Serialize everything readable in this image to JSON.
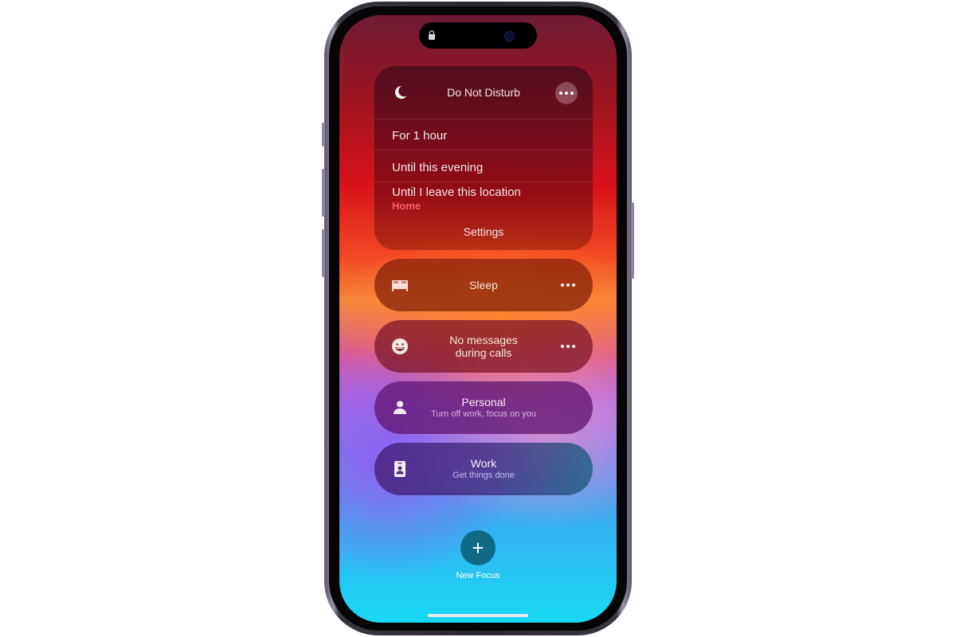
{
  "device": {
    "model": "iPhone",
    "status_icon": "lock-icon"
  },
  "dnd": {
    "title": "Do Not Disturb",
    "icon": "moon-icon",
    "more_icon": "ellipsis-icon",
    "options": [
      {
        "label": "For 1 hour"
      },
      {
        "label": "Until this evening"
      },
      {
        "label": "Until I leave this location",
        "sublabel": "Home"
      }
    ],
    "settings_label": "Settings",
    "accent_color": "#ff5b6e"
  },
  "focus_modes": [
    {
      "name": "Sleep",
      "subtitle": "",
      "icon": "bed-icon",
      "has_more": true
    },
    {
      "name": "No messages during calls",
      "line1": "No messages",
      "line2": "during calls",
      "icon": "smiley-icon",
      "has_more": true
    },
    {
      "name": "Personal",
      "subtitle": "Turn off work, focus on you",
      "icon": "person-icon",
      "has_more": false
    },
    {
      "name": "Work",
      "subtitle": "Get things done",
      "icon": "id-badge-icon",
      "has_more": false
    }
  ],
  "new_focus": {
    "symbol": "+",
    "label": "New Focus"
  }
}
